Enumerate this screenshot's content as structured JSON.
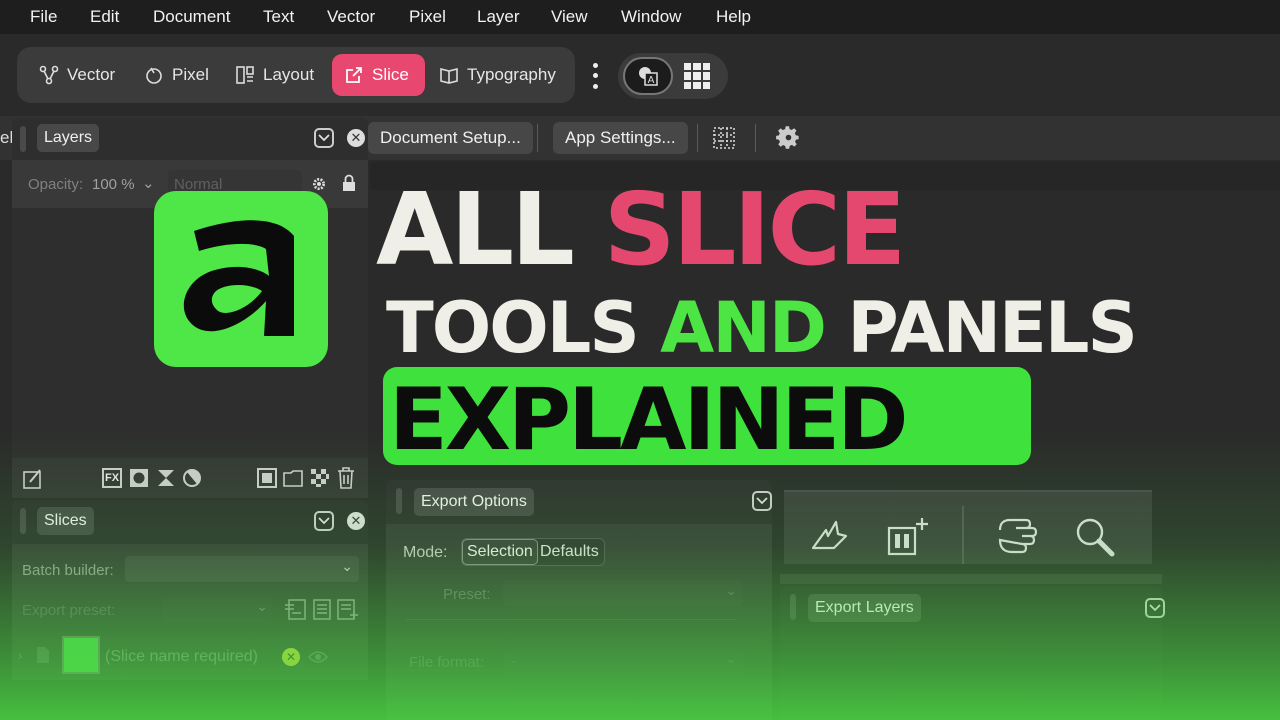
{
  "menu": [
    "File",
    "Edit",
    "Document",
    "Text",
    "Vector",
    "Pixel",
    "Layer",
    "View",
    "Window",
    "Help"
  ],
  "personas": [
    {
      "label": "Vector",
      "icon": "vector-persona-icon"
    },
    {
      "label": "Pixel",
      "icon": "pixel-persona-icon"
    },
    {
      "label": "Layout",
      "icon": "layout-persona-icon"
    },
    {
      "label": "Slice",
      "icon": "slice-persona-icon",
      "active": true
    },
    {
      "label": "Typography",
      "icon": "typography-persona-icon"
    }
  ],
  "toolbar": {
    "left_clip": "ele",
    "document_setup": "Document Setup...",
    "app_settings": "App Settings..."
  },
  "layers_panel": {
    "tab": "Layers",
    "opacity_label": "Opacity:",
    "opacity_value": "100 %",
    "blend_mode": "Normal"
  },
  "slices_panel": {
    "tab": "Slices",
    "batch_builder_label": "Batch builder:",
    "export_preset_label": "Export preset:",
    "slice_name": "(Slice name required)"
  },
  "export_options_panel": {
    "tab": "Export Options",
    "mode_label": "Mode:",
    "mode_selection": "Selection",
    "mode_defaults": "Defaults",
    "preset_label": "Preset:",
    "file_format_label": "File format:",
    "file_format_value": "-"
  },
  "export_layers_panel": {
    "tab": "Export Layers"
  },
  "overlay": {
    "line1_a": "ALL",
    "line1_b": "SLICE",
    "line2_a": "TOOLS",
    "line2_b": "AND",
    "line2_c": "PANELS",
    "line3": "EXPLAINED"
  },
  "colors": {
    "accent_pink": "#e5486f",
    "accent_green": "#4ce544",
    "active_persona": "#e8476f"
  }
}
